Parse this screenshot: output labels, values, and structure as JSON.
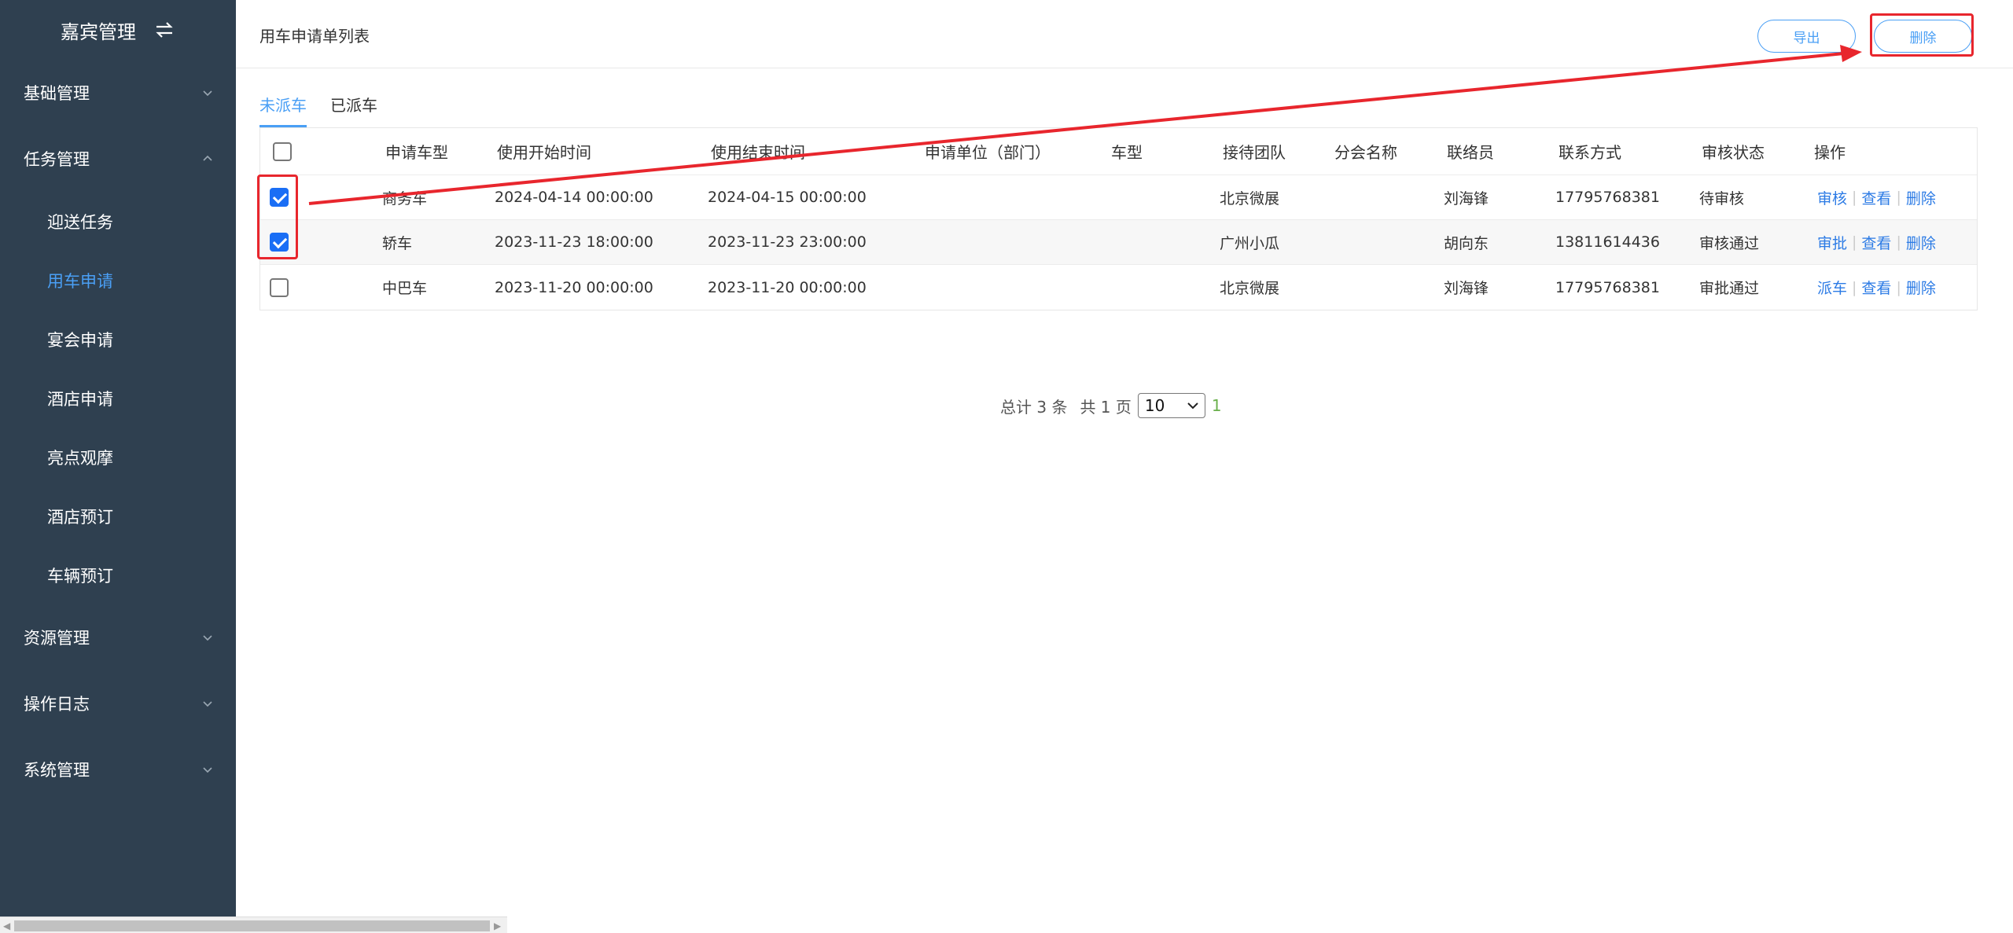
{
  "sidebar": {
    "brand": "嘉宾管理",
    "groups": [
      {
        "label": "基础管理"
      },
      {
        "label": "任务管理"
      },
      {
        "label": "资源管理"
      },
      {
        "label": "操作日志"
      },
      {
        "label": "系统管理"
      }
    ],
    "task_items": [
      {
        "label": "迎送任务"
      },
      {
        "label": "用车申请"
      },
      {
        "label": "宴会申请"
      },
      {
        "label": "酒店申请"
      },
      {
        "label": "亮点观摩"
      },
      {
        "label": "酒店预订"
      },
      {
        "label": "车辆预订"
      }
    ]
  },
  "header": {
    "title": "用车申请单列表",
    "export_label": "导出",
    "delete_label": "删除"
  },
  "tabs": [
    {
      "label": "未派车",
      "active": true
    },
    {
      "label": "已派车",
      "active": false
    }
  ],
  "table": {
    "columns": [
      "申请车型",
      "使用开始时间",
      "使用结束时间",
      "申请单位（部门）",
      "车型",
      "接待团队",
      "分会名称",
      "联络员",
      "联系方式",
      "审核状态",
      "操作"
    ],
    "header_checked": false,
    "rows": [
      {
        "checked": true,
        "vehicle": "商务车",
        "start": "2024-04-14 00:00:00",
        "end": "2024-04-15 00:00:00",
        "unit": "",
        "car_model": "",
        "team": "北京微展",
        "branch": "",
        "contact": "刘海锋",
        "phone": "17795768381",
        "status": "待审核",
        "actions": [
          "审核",
          "查看",
          "删除"
        ]
      },
      {
        "checked": true,
        "vehicle": "轿车",
        "start": "2023-11-23 18:00:00",
        "end": "2023-11-23 23:00:00",
        "unit": "",
        "car_model": "",
        "team": "广州小瓜",
        "branch": "",
        "contact": "胡向东",
        "phone": "13811614436",
        "status": "审核通过",
        "actions": [
          "审批",
          "查看",
          "删除"
        ]
      },
      {
        "checked": false,
        "vehicle": "中巴车",
        "start": "2023-11-20 00:00:00",
        "end": "2023-11-20 00:00:00",
        "unit": "",
        "car_model": "",
        "team": "北京微展",
        "branch": "",
        "contact": "刘海锋",
        "phone": "17795768381",
        "status": "审批通过",
        "actions": [
          "派车",
          "查看",
          "删除"
        ]
      }
    ]
  },
  "pagination": {
    "total_text": "总计 3 条",
    "pages_text": "共 1 页",
    "page_size": "10",
    "current_page": "1"
  },
  "colors": {
    "sidebar_bg": "#2f4050",
    "accent": "#4a9ff5",
    "annotation": "#e8262d"
  }
}
